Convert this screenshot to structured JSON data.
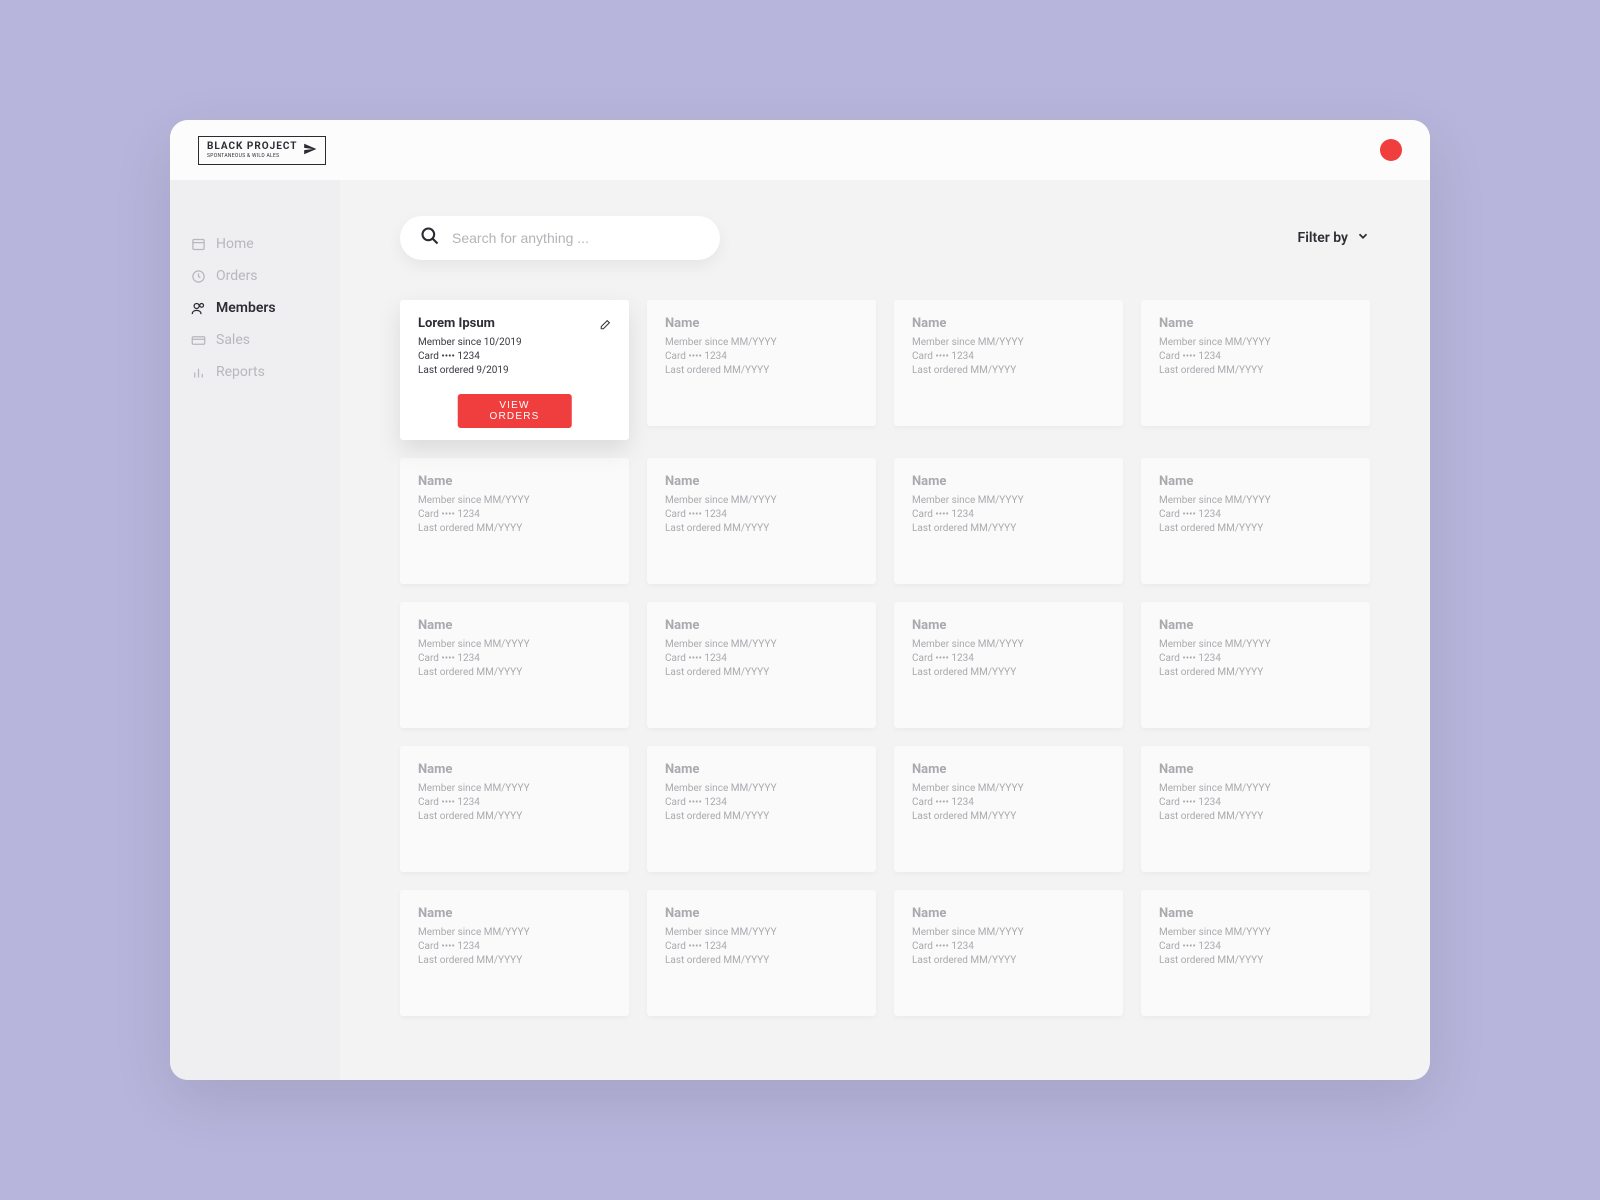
{
  "brand": {
    "name": "BLACK PROJECT",
    "tagline": "SPONTANEOUS & WILD ALES"
  },
  "sidebar": {
    "items": [
      {
        "label": "Home"
      },
      {
        "label": "Orders"
      },
      {
        "label": "Members"
      },
      {
        "label": "Sales"
      },
      {
        "label": "Reports"
      }
    ]
  },
  "toolbar": {
    "search_placeholder": "Search for anything ...",
    "filter_label": "Filter by"
  },
  "member_labels": {
    "since_prefix": "Member since",
    "card_prefix": "Card",
    "last_prefix": "Last ordered"
  },
  "members": [
    {
      "name": "Lorem Ipsum",
      "since": "10/2019",
      "card": "•••• 1234",
      "last": "9/2019",
      "active": true,
      "view_label": "VIEW ORDERS"
    },
    {
      "name": "Name",
      "since": "MM/YYYY",
      "card": "•••• 1234",
      "last": "MM/YYYY"
    },
    {
      "name": "Name",
      "since": "MM/YYYY",
      "card": "•••• 1234",
      "last": "MM/YYYY"
    },
    {
      "name": "Name",
      "since": "MM/YYYY",
      "card": "•••• 1234",
      "last": "MM/YYYY"
    },
    {
      "name": "Name",
      "since": "MM/YYYY",
      "card": "•••• 1234",
      "last": "MM/YYYY"
    },
    {
      "name": "Name",
      "since": "MM/YYYY",
      "card": "•••• 1234",
      "last": "MM/YYYY"
    },
    {
      "name": "Name",
      "since": "MM/YYYY",
      "card": "•••• 1234",
      "last": "MM/YYYY"
    },
    {
      "name": "Name",
      "since": "MM/YYYY",
      "card": "•••• 1234",
      "last": "MM/YYYY"
    },
    {
      "name": "Name",
      "since": "MM/YYYY",
      "card": "•••• 1234",
      "last": "MM/YYYY"
    },
    {
      "name": "Name",
      "since": "MM/YYYY",
      "card": "•••• 1234",
      "last": "MM/YYYY"
    },
    {
      "name": "Name",
      "since": "MM/YYYY",
      "card": "•••• 1234",
      "last": "MM/YYYY"
    },
    {
      "name": "Name",
      "since": "MM/YYYY",
      "card": "•••• 1234",
      "last": "MM/YYYY"
    },
    {
      "name": "Name",
      "since": "MM/YYYY",
      "card": "•••• 1234",
      "last": "MM/YYYY"
    },
    {
      "name": "Name",
      "since": "MM/YYYY",
      "card": "•••• 1234",
      "last": "MM/YYYY"
    },
    {
      "name": "Name",
      "since": "MM/YYYY",
      "card": "•••• 1234",
      "last": "MM/YYYY"
    },
    {
      "name": "Name",
      "since": "MM/YYYY",
      "card": "•••• 1234",
      "last": "MM/YYYY"
    },
    {
      "name": "Name",
      "since": "MM/YYYY",
      "card": "•••• 1234",
      "last": "MM/YYYY"
    },
    {
      "name": "Name",
      "since": "MM/YYYY",
      "card": "•••• 1234",
      "last": "MM/YYYY"
    },
    {
      "name": "Name",
      "since": "MM/YYYY",
      "card": "•••• 1234",
      "last": "MM/YYYY"
    },
    {
      "name": "Name",
      "since": "MM/YYYY",
      "card": "•••• 1234",
      "last": "MM/YYYY"
    }
  ],
  "colors": {
    "accent": "#f03e3e",
    "page_bg": "#b7b5db"
  }
}
